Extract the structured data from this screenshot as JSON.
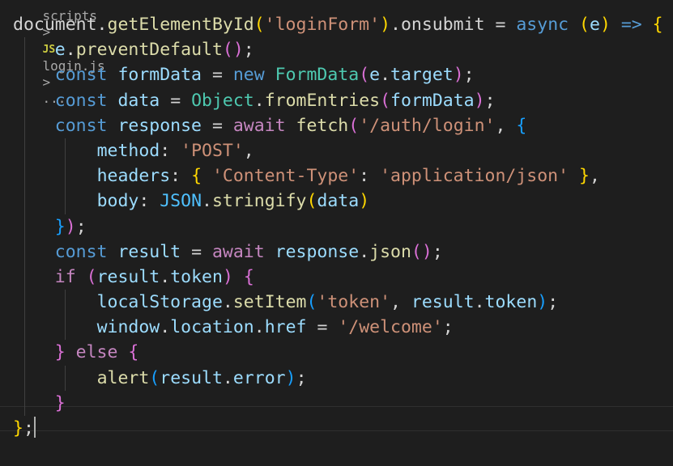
{
  "breadcrumb": {
    "folder": "scripts",
    "separator": ">",
    "file_icon": "JS",
    "file": "login.js",
    "tail": "..."
  },
  "lines": [
    [
      [
        "document.",
        "p"
      ],
      [
        "getElementById",
        "fn"
      ],
      [
        "(",
        "b1"
      ],
      [
        "'loginForm'",
        "str"
      ],
      [
        ")",
        "b1"
      ],
      [
        ".onsubmit ",
        "p"
      ],
      [
        "= ",
        "p"
      ],
      [
        "async ",
        "kw"
      ],
      [
        "(",
        "b1"
      ],
      [
        "e",
        "var"
      ],
      [
        ") ",
        "b1"
      ],
      [
        "=> ",
        "kw"
      ],
      [
        "{",
        "b1"
      ]
    ],
    [
      [
        "    ",
        "p"
      ],
      [
        "e",
        "var"
      ],
      [
        ".",
        "p"
      ],
      [
        "preventDefault",
        "fn"
      ],
      [
        "()",
        "b2"
      ],
      [
        ";",
        "p"
      ]
    ],
    [
      [
        "    ",
        "p"
      ],
      [
        "const ",
        "kw"
      ],
      [
        "formData ",
        "var"
      ],
      [
        "= ",
        "p"
      ],
      [
        "new ",
        "kw"
      ],
      [
        "FormData",
        "cls"
      ],
      [
        "(",
        "b2"
      ],
      [
        "e",
        "var"
      ],
      [
        ".",
        "p"
      ],
      [
        "target",
        "var"
      ],
      [
        ")",
        "b2"
      ],
      [
        ";",
        "p"
      ]
    ],
    [
      [
        "    ",
        "p"
      ],
      [
        "const ",
        "kw"
      ],
      [
        "data ",
        "var"
      ],
      [
        "= ",
        "p"
      ],
      [
        "Object",
        "cls"
      ],
      [
        ".",
        "p"
      ],
      [
        "fromEntries",
        "fn"
      ],
      [
        "(",
        "b2"
      ],
      [
        "formData",
        "var"
      ],
      [
        ")",
        "b2"
      ],
      [
        ";",
        "p"
      ]
    ],
    [
      [
        "    ",
        "p"
      ],
      [
        "const ",
        "kw"
      ],
      [
        "response ",
        "var"
      ],
      [
        "= ",
        "p"
      ],
      [
        "await ",
        "ctl"
      ],
      [
        "fetch",
        "fn"
      ],
      [
        "(",
        "b2"
      ],
      [
        "'/auth/login'",
        "str"
      ],
      [
        ", ",
        "p"
      ],
      [
        "{",
        "b3"
      ]
    ],
    [
      [
        "        ",
        "p"
      ],
      [
        "method",
        "var"
      ],
      [
        ": ",
        "p"
      ],
      [
        "'POST'",
        "str"
      ],
      [
        ",",
        "p"
      ]
    ],
    [
      [
        "        ",
        "p"
      ],
      [
        "headers",
        "var"
      ],
      [
        ": ",
        "p"
      ],
      [
        "{ ",
        "b1"
      ],
      [
        "'Content-Type'",
        "str"
      ],
      [
        ": ",
        "p"
      ],
      [
        "'application/json'",
        "str"
      ],
      [
        " }",
        "b1"
      ],
      [
        ",",
        "p"
      ]
    ],
    [
      [
        "        ",
        "p"
      ],
      [
        "body",
        "var"
      ],
      [
        ": ",
        "p"
      ],
      [
        "JSON",
        "const"
      ],
      [
        ".",
        "p"
      ],
      [
        "stringify",
        "fn"
      ],
      [
        "(",
        "b1"
      ],
      [
        "data",
        "var"
      ],
      [
        ")",
        "b1"
      ]
    ],
    [
      [
        "    ",
        "p"
      ],
      [
        "}",
        "b3"
      ],
      [
        ")",
        "b2"
      ],
      [
        ";",
        "p"
      ]
    ],
    [
      [
        "    ",
        "p"
      ],
      [
        "const ",
        "kw"
      ],
      [
        "result ",
        "var"
      ],
      [
        "= ",
        "p"
      ],
      [
        "await ",
        "ctl"
      ],
      [
        "response",
        "var"
      ],
      [
        ".",
        "p"
      ],
      [
        "json",
        "fn"
      ],
      [
        "()",
        "b2"
      ],
      [
        ";",
        "p"
      ]
    ],
    [
      [
        "    ",
        "p"
      ],
      [
        "if ",
        "ctl"
      ],
      [
        "(",
        "b2"
      ],
      [
        "result",
        "var"
      ],
      [
        ".",
        "p"
      ],
      [
        "token",
        "var"
      ],
      [
        ") ",
        "b2"
      ],
      [
        "{",
        "b2"
      ]
    ],
    [
      [
        "        ",
        "p"
      ],
      [
        "localStorage",
        "var"
      ],
      [
        ".",
        "p"
      ],
      [
        "setItem",
        "fn"
      ],
      [
        "(",
        "b3"
      ],
      [
        "'token'",
        "str"
      ],
      [
        ", ",
        "p"
      ],
      [
        "result",
        "var"
      ],
      [
        ".",
        "p"
      ],
      [
        "token",
        "var"
      ],
      [
        ")",
        "b3"
      ],
      [
        ";",
        "p"
      ]
    ],
    [
      [
        "        ",
        "p"
      ],
      [
        "window",
        "var"
      ],
      [
        ".",
        "p"
      ],
      [
        "location",
        "var"
      ],
      [
        ".",
        "p"
      ],
      [
        "href ",
        "var"
      ],
      [
        "= ",
        "p"
      ],
      [
        "'/welcome'",
        "str"
      ],
      [
        ";",
        "p"
      ]
    ],
    [
      [
        "    ",
        "p"
      ],
      [
        "} ",
        "b2"
      ],
      [
        "else ",
        "ctl"
      ],
      [
        "{",
        "b2"
      ]
    ],
    [
      [
        "        ",
        "p"
      ],
      [
        "alert",
        "fn"
      ],
      [
        "(",
        "b3"
      ],
      [
        "result",
        "var"
      ],
      [
        ".",
        "p"
      ],
      [
        "error",
        "var"
      ],
      [
        ")",
        "b3"
      ],
      [
        ";",
        "p"
      ]
    ],
    [
      [
        "    ",
        "p"
      ],
      [
        "}",
        "b2"
      ]
    ],
    [
      [
        "}",
        "b1"
      ],
      [
        ";",
        "p"
      ]
    ]
  ]
}
